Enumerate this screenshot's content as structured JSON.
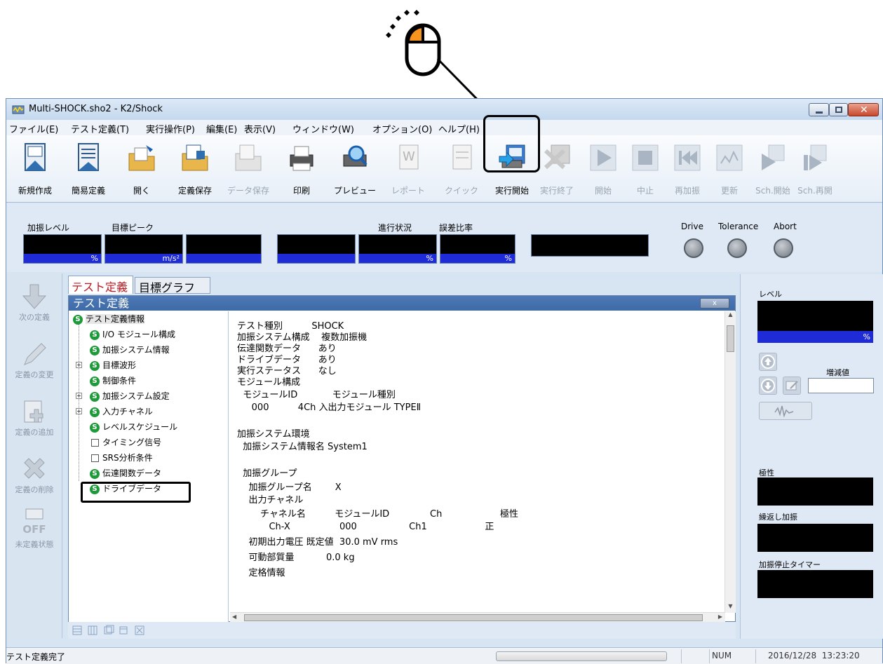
{
  "window": {
    "title": "Multi-SHOCK.sho2 - K2/Shock"
  },
  "menu": [
    "ファイル(E)",
    "テスト定義(T)",
    "実行操作(P)",
    "編集(E)",
    "表示(V)",
    "ウィンドウ(W)",
    "オプション(O)",
    "ヘルプ(H)"
  ],
  "toolbar": [
    {
      "label": "新規作成",
      "enabled": true
    },
    {
      "label": "簡易定義",
      "enabled": true
    },
    {
      "label": "開く",
      "enabled": true
    },
    {
      "label": "定義保存",
      "enabled": true
    },
    {
      "label": "データ保存",
      "enabled": false
    },
    {
      "label": "印刷",
      "enabled": true
    },
    {
      "label": "プレビュー",
      "enabled": true
    },
    {
      "label": "レポート",
      "enabled": false
    },
    {
      "label": "クイック",
      "enabled": false
    },
    {
      "label": "実行開始",
      "enabled": true
    },
    {
      "label": "実行終了",
      "enabled": false
    },
    {
      "label": "開始",
      "enabled": false
    },
    {
      "label": "中止",
      "enabled": false
    },
    {
      "label": "再加振",
      "enabled": false
    },
    {
      "label": "更新",
      "enabled": false
    },
    {
      "label": "Sch.開始",
      "enabled": false
    },
    {
      "label": "Sch.再開",
      "enabled": false
    }
  ],
  "status_panel": {
    "labels": {
      "level": "加振レベル",
      "target_peak": "目標ピーク",
      "progress": "進行状況",
      "error_ratio": "誤差比率",
      "drive": "Drive",
      "tolerance": "Tolerance",
      "abort": "Abort"
    },
    "units": {
      "level": "%",
      "target_peak": "m/s²",
      "progress": "%",
      "error_ratio": "%"
    }
  },
  "left_nav": [
    "次の定義",
    "定義の変更",
    "定義の追加",
    "定義の削除",
    "未定義状態"
  ],
  "left_nav_off": "OFF",
  "tabs": [
    "テスト定義",
    "目標グラフ"
  ],
  "child_window": {
    "title": "テスト定義",
    "close": "x"
  },
  "tree": [
    {
      "label": "テスト定義情報",
      "icon": "S"
    },
    {
      "label": "I/O モジュール構成",
      "icon": "S"
    },
    {
      "label": "加振システム情報",
      "icon": "S"
    },
    {
      "label": "目標波形",
      "icon": "S"
    },
    {
      "label": "制御条件",
      "icon": "S"
    },
    {
      "label": "加振システム設定",
      "icon": "S"
    },
    {
      "label": "入力チャネル",
      "icon": "S"
    },
    {
      "label": "レベルスケジュール",
      "icon": "S"
    },
    {
      "label": "タイミング信号",
      "icon": "box"
    },
    {
      "label": "SRS分析条件",
      "icon": "box"
    },
    {
      "label": "伝達関数データ",
      "icon": "S"
    },
    {
      "label": "ドライブデータ",
      "icon": "S"
    }
  ],
  "detail": [
    "テスト種別          SHOCK",
    "加振システム構成    複数加振機",
    "伝達関数データ      あり",
    "ドライブデータ      あり",
    "実行ステータス      なし",
    "モジュール構成",
    "  モジュールID            モジュール種別",
    "     000          4Ch 入出力モジュール TYPEⅡ",
    "",
    "加振システム環境",
    "  加振システム情報名 System1",
    "",
    "  加振グループ",
    "    加振グループ名        X",
    "    出力チャネル",
    "        チャネル名          モジュールID              Ch                    極性",
    "           Ch-X                 000                  Ch1                    正",
    "    初期出力電圧 既定値  30.0 mV rms",
    "    可動部質量           0.0 kg",
    "    定格情報"
  ],
  "right_panel": {
    "level_label": "レベル",
    "level_unit": "%",
    "inc_label": "増減値",
    "polarity_label": "極性",
    "repeat_label": "繰返し加振",
    "timer_label": "加振停止タイマー"
  },
  "statusbar": {
    "message": "テスト定義完了",
    "num": "NUM",
    "datetime": "2016/12/28  13:23:20"
  },
  "colors": {
    "titlebar": "#c4d8ee",
    "meter_unit_bar": "#1e2bd6",
    "tab_active_text": "#c0161e",
    "child_title": "#3d6aa8",
    "tree_icon": "#1f9a3a"
  }
}
